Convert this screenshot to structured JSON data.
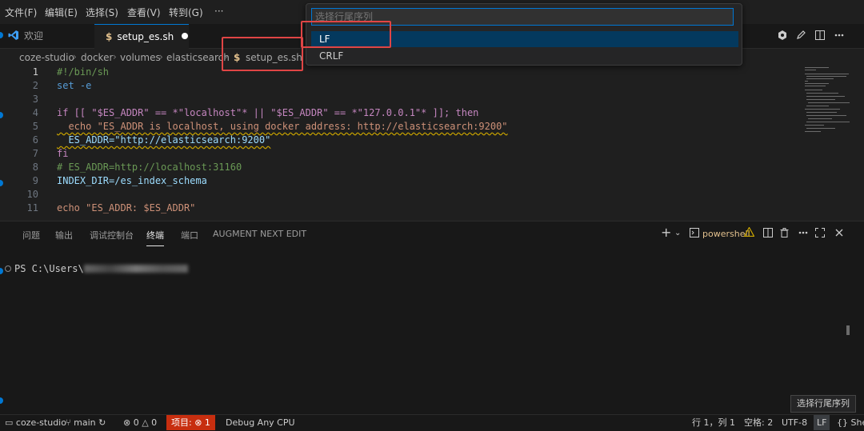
{
  "menu": [
    "文件(F)",
    "编辑(E)",
    "选择(S)",
    "查看(V)",
    "转到(G)",
    "···"
  ],
  "tabs": [
    {
      "label": "欢迎",
      "icon": "vscode-logo-icon"
    },
    {
      "label": "setup_es.sh",
      "icon": "dollar-icon",
      "modified": true
    }
  ],
  "breadcrumb": [
    "coze-studio",
    "docker",
    "volumes",
    "elasticsearch",
    "setup_es.sh"
  ],
  "quick_pick": {
    "placeholder": "选择行尾序列",
    "options": [
      "LF",
      "CRLF"
    ],
    "selected": "LF"
  },
  "editor": {
    "line_numbers": [
      "1",
      "2",
      "3",
      "4",
      "5",
      "6",
      "7",
      "8",
      "9",
      "10",
      "11"
    ],
    "lines": [
      "#!/bin/sh",
      "set -e",
      "",
      "if [[ \"$ES_ADDR\" == *\"localhost\"* || \"$ES_ADDR\" == *\"127.0.0.1\"* ]]; then",
      "  echo \"ES_ADDR is localhost, using docker address: http://elasticsearch:9200\"",
      "  ES_ADDR=\"http://elasticsearch:9200\"",
      "fi",
      "# ES_ADDR=http://localhost:31160",
      "INDEX_DIR=/es_index_schema",
      "",
      "echo \"ES_ADDR: $ES_ADDR\""
    ]
  },
  "panel": {
    "tabs": [
      "问题",
      "输出",
      "调试控制台",
      "终端",
      "端口",
      "AUGMENT NEXT EDIT"
    ],
    "active_tab": "终端",
    "terminal_label": "powershell",
    "prompt": "PS C:\\Users\\"
  },
  "tooltip": "选择行尾序列",
  "statusbar": {
    "remote": "coze-studio",
    "branch": "main",
    "errors": "0",
    "warnings": "0",
    "problems": "项目: ⊗ 1",
    "debug": "Debug Any CPU",
    "position": "行 1，列 1",
    "spaces": "空格: 2",
    "encoding": "UTF-8",
    "eol": "LF",
    "language": "{} She"
  },
  "colors": {
    "accent": "#0078d4",
    "highlight_box": "#e04545",
    "problems_bg": "#c72e0f",
    "selected_option": "#04395e"
  }
}
